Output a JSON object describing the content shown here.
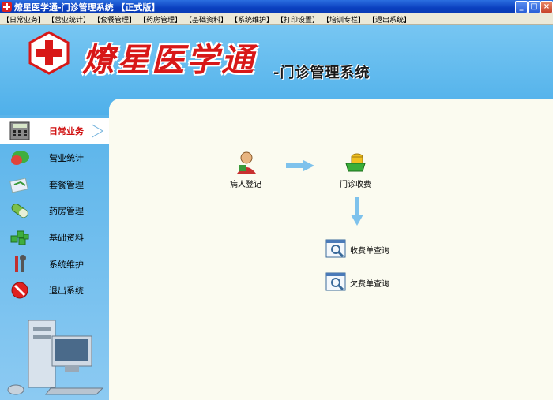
{
  "window": {
    "title": "燎星医学通-门诊管理系统 【正式版】",
    "controls": [
      "_",
      "□",
      "×"
    ]
  },
  "menu": [
    "【日常业务】",
    "【营业统计】",
    "【套餐管理】",
    "【药房管理】",
    "【基础资料】",
    "【系统维护】",
    "【打印设置】",
    "【培训专栏】",
    "【退出系统】"
  ],
  "header": {
    "brand": "燎星医学通",
    "subtitle": "-门诊管理系统"
  },
  "sidebar": {
    "items": [
      {
        "label": "日常业务",
        "icon": "calculator-icon",
        "active": true
      },
      {
        "label": "营业统计",
        "icon": "chart-icon",
        "active": false
      },
      {
        "label": "套餐管理",
        "icon": "package-icon",
        "active": false
      },
      {
        "label": "药房管理",
        "icon": "pill-icon",
        "active": false
      },
      {
        "label": "基础资料",
        "icon": "cubes-icon",
        "active": false
      },
      {
        "label": "系统维护",
        "icon": "tools-icon",
        "active": false
      },
      {
        "label": "退出系统",
        "icon": "exit-icon",
        "active": false
      }
    ]
  },
  "workflow": {
    "patient_register": "病人登记",
    "outpatient_charge": "门诊收费",
    "charge_query": "收费单查询",
    "arrears_query": "欠费单查询"
  },
  "colors": {
    "accent_red": "#d81818",
    "sky_blue": "#5ab4ea"
  }
}
